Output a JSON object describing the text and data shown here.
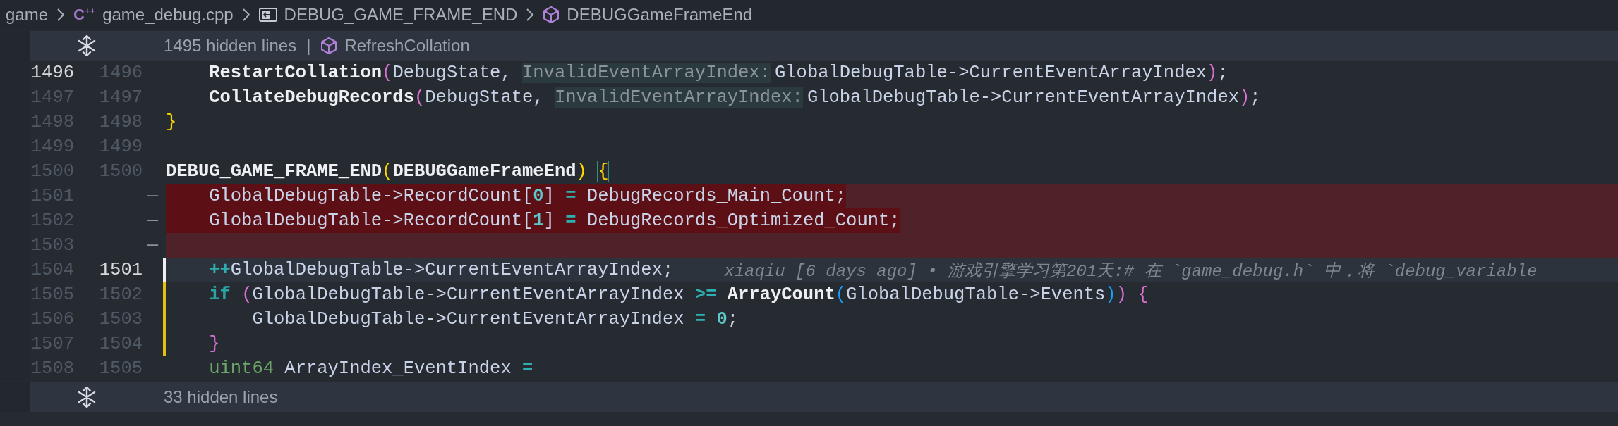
{
  "breadcrumbs": [
    {
      "kind": "folder",
      "label": "game"
    },
    {
      "kind": "file",
      "icon_text": "C$^{++}$",
      "label": "game_debug.cpp"
    },
    {
      "kind": "macro",
      "label": "DEBUG_GAME_FRAME_END"
    },
    {
      "kind": "method",
      "label": "DEBUGGameFrameEnd"
    }
  ],
  "top_fold": {
    "label": "1495 hidden lines",
    "separator": "|",
    "symbol": "RefreshCollation"
  },
  "lines": [
    {
      "old": "1496",
      "new": "1496",
      "kind": "context",
      "old_current": true,
      "new_current": false,
      "cursor": false,
      "modified": false,
      "tokens": [
        {
          "kind": "fn",
          "text": "    RestartCollation"
        },
        {
          "kind": "b2",
          "text": "("
        },
        {
          "kind": "text",
          "text": "DebugState, "
        },
        {
          "kind": "hint",
          "text": "InvalidEventArrayIndex:"
        },
        {
          "kind": "text",
          "text": "GlobalDebugTable->CurrentEventArrayIndex"
        },
        {
          "kind": "b2",
          "text": ")"
        },
        {
          "kind": "text",
          "text": ";"
        }
      ]
    },
    {
      "old": "1497",
      "new": "1497",
      "kind": "context",
      "old_current": false,
      "new_current": false,
      "cursor": false,
      "modified": false,
      "tokens": [
        {
          "kind": "fn",
          "text": "    CollateDebugRecords"
        },
        {
          "kind": "b2",
          "text": "("
        },
        {
          "kind": "text",
          "text": "DebugState, "
        },
        {
          "kind": "hint",
          "text": "InvalidEventArrayIndex:"
        },
        {
          "kind": "text",
          "text": "GlobalDebugTable->CurrentEventArrayIndex"
        },
        {
          "kind": "b2",
          "text": ")"
        },
        {
          "kind": "text",
          "text": ";"
        }
      ]
    },
    {
      "old": "1498",
      "new": "1498",
      "kind": "context",
      "old_current": false,
      "new_current": false,
      "cursor": false,
      "modified": false,
      "tokens": [
        {
          "kind": "b1",
          "text": "}"
        }
      ]
    },
    {
      "old": "1499",
      "new": "1499",
      "kind": "context",
      "old_current": false,
      "new_current": false,
      "cursor": false,
      "modified": false
    },
    {
      "old": "1500",
      "new": "1500",
      "kind": "context",
      "old_current": false,
      "new_current": false,
      "cursor": false,
      "modified": false,
      "tokens": [
        {
          "kind": "macro",
          "text": "DEBUG_GAME_FRAME_END"
        },
        {
          "kind": "b1",
          "text": "("
        },
        {
          "kind": "macro",
          "text": "DEBUGGameFrameEnd"
        },
        {
          "kind": "b1",
          "text": ")"
        },
        {
          "kind": "match",
          "text": "{"
        }
      ]
    },
    {
      "old": "1501",
      "marker": "—",
      "kind": "deleted",
      "old_current": false,
      "cursor": false,
      "modified": false,
      "tokens": [
        {
          "kind": "text",
          "text": "    GlobalDebugTable->RecordCount["
        },
        {
          "kind": "num",
          "text": "0"
        },
        {
          "kind": "text",
          "text": "] "
        },
        {
          "kind": "op",
          "text": "="
        },
        {
          "kind": "text",
          "text": " DebugRecords_Main_Count;"
        }
      ]
    },
    {
      "old": "1502",
      "marker": "—",
      "kind": "deleted",
      "old_current": false,
      "cursor": false,
      "modified": false,
      "tokens": [
        {
          "kind": "text",
          "text": "    GlobalDebugTable->RecordCount["
        },
        {
          "kind": "num",
          "text": "1"
        },
        {
          "kind": "text",
          "text": "] "
        },
        {
          "kind": "op",
          "text": "="
        },
        {
          "kind": "text",
          "text": " DebugRecords_Optimized_Count;"
        }
      ]
    },
    {
      "old": "1503",
      "marker": "—",
      "kind": "deleted",
      "old_current": false,
      "cursor": false,
      "modified": false
    },
    {
      "old": "1504",
      "new": "1501",
      "kind": "context",
      "old_current": false,
      "new_current": true,
      "cursor": true,
      "modified": false,
      "tokens": [
        {
          "kind": "op",
          "text": "    ++"
        },
        {
          "kind": "text",
          "text": "GlobalDebugTable->CurrentEventArrayIndex;"
        }
      ],
      "blame": "xiaqiu [6 days ago] • 游戏引擎学习第201天:# 在 `game_debug.h` 中，将 `debug_variable"
    },
    {
      "old": "1505",
      "new": "1502",
      "kind": "context",
      "old_current": false,
      "new_current": false,
      "cursor": false,
      "modified": true,
      "tokens": [
        {
          "kind": "kw",
          "text": "    if"
        },
        {
          "kind": "b2",
          "text": " ("
        },
        {
          "kind": "text",
          "text": "GlobalDebugTable->CurrentEventArrayIndex "
        },
        {
          "kind": "op",
          "text": ">="
        },
        {
          "kind": "fn",
          "text": " ArrayCount"
        },
        {
          "kind": "b3",
          "text": "("
        },
        {
          "kind": "text",
          "text": "GlobalDebugTable->Events"
        },
        {
          "kind": "b3",
          "text": ")"
        },
        {
          "kind": "b2",
          "text": ") {"
        }
      ]
    },
    {
      "old": "1506",
      "new": "1503",
      "kind": "context",
      "old_current": false,
      "new_current": false,
      "cursor": false,
      "modified": true,
      "tokens": [
        {
          "kind": "text",
          "text": "        GlobalDebugTable->CurrentEventArrayIndex "
        },
        {
          "kind": "op",
          "text": "="
        },
        {
          "kind": "num",
          "text": " 0"
        },
        {
          "kind": "text",
          "text": ";"
        }
      ]
    },
    {
      "old": "1507",
      "new": "1504",
      "kind": "context",
      "old_current": false,
      "new_current": false,
      "cursor": false,
      "modified": true,
      "tokens": [
        {
          "kind": "b2",
          "text": "    }"
        }
      ]
    },
    {
      "old": "1508",
      "new": "1505",
      "kind": "context",
      "old_current": false,
      "new_current": false,
      "cursor": false,
      "modified": false,
      "tokens": [
        {
          "kind": "type",
          "text": "    uint64"
        },
        {
          "kind": "text",
          "text": " ArrayIndex_EventIndex "
        },
        {
          "kind": "op",
          "text": "="
        }
      ]
    }
  ],
  "bottom_fold": {
    "label": "33 hidden lines"
  }
}
